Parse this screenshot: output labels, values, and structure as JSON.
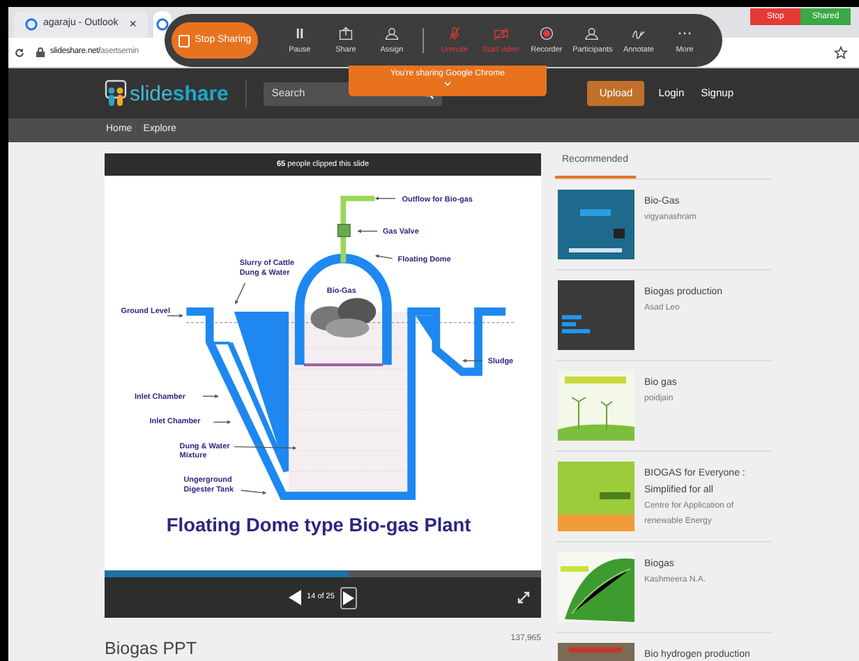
{
  "browser": {
    "tabs": [
      {
        "title": "agaraju - Outlook",
        "close": "×",
        "selected": false
      },
      {
        "selected": true
      }
    ],
    "address": {
      "host": "slideshare.net/",
      "path": "asertsemin"
    }
  },
  "meeting_toolbar": {
    "stop_sharing": "Stop Sharing",
    "controls": [
      {
        "kind": "pause",
        "label": "Pause",
        "off": false
      },
      {
        "kind": "share",
        "label": "Share",
        "off": false
      },
      {
        "kind": "assign",
        "label": "Assign",
        "off": false
      },
      {
        "kind": "mic",
        "label": "Unmute",
        "off": true
      },
      {
        "kind": "video",
        "label": "Start video",
        "off": true
      },
      {
        "kind": "recorder",
        "label": "Recorder",
        "off": false
      },
      {
        "kind": "participants",
        "label": "Participants",
        "off": false
      },
      {
        "kind": "annotate",
        "label": "Annotate",
        "off": false
      },
      {
        "kind": "more",
        "label": "More",
        "off": false
      }
    ],
    "banner": "You're sharing Google Chrome",
    "corner_buttons": [
      {
        "kind": "stop",
        "label": "Stop"
      },
      {
        "kind": "shared",
        "label": "Shared"
      }
    ]
  },
  "site_header": {
    "logo_light": "slide",
    "logo_bold": "share",
    "search_placeholder": "Search",
    "upload": "Upload",
    "links": [
      "Login",
      "Signup"
    ],
    "nav": [
      "Home",
      "Explore"
    ]
  },
  "slide": {
    "clip_text": "**65** people clipped this slide",
    "labels": [
      {
        "lines": [
          "Outflow for Bio-gas"
        ]
      },
      {
        "lines": [
          "Gas Valve"
        ]
      },
      {
        "lines": [
          "Floating Dome"
        ]
      },
      {
        "lines": [
          "Slurry of Cattle",
          "Dung & Water"
        ]
      },
      {
        "lines": [
          "Bio-Gas"
        ]
      },
      {
        "lines": [
          "Ground Level"
        ]
      },
      {
        "lines": [
          "Sludge"
        ]
      },
      {
        "lines": [
          "Inlet Chamber"
        ]
      },
      {
        "lines": [
          "Inlet Chamber"
        ]
      },
      {
        "lines": [
          "Dung & Water",
          "Mixture"
        ]
      },
      {
        "lines": [
          "Ungerground",
          "Digester Tank"
        ]
      }
    ],
    "caption": "Floating Dome type Bio-gas Plant",
    "progress": {
      "level": 0.56
    },
    "counter": "14 of 25"
  },
  "title": "Biogas PPT",
  "views": "137,965",
  "recommended": {
    "tab": "Recommended",
    "items": [
      {
        "title": [
          "Bio-Gas"
        ],
        "author": [
          "vigyanashram"
        ]
      },
      {
        "title": [
          "Biogas production"
        ],
        "author": [
          "Asad Leo"
        ]
      },
      {
        "title": [
          "Bio gas"
        ],
        "author": [
          "poidjain"
        ]
      },
      {
        "title": [
          "BIOGAS for Everyone :",
          "Simplified for all"
        ],
        "author": [
          "Centre for Application of",
          "renewable Energy"
        ]
      },
      {
        "title": [
          "Biogas"
        ],
        "author": [
          "Kashmeera N.A."
        ]
      },
      {
        "title": [
          "Bio hydrogen production"
        ]
      }
    ]
  }
}
